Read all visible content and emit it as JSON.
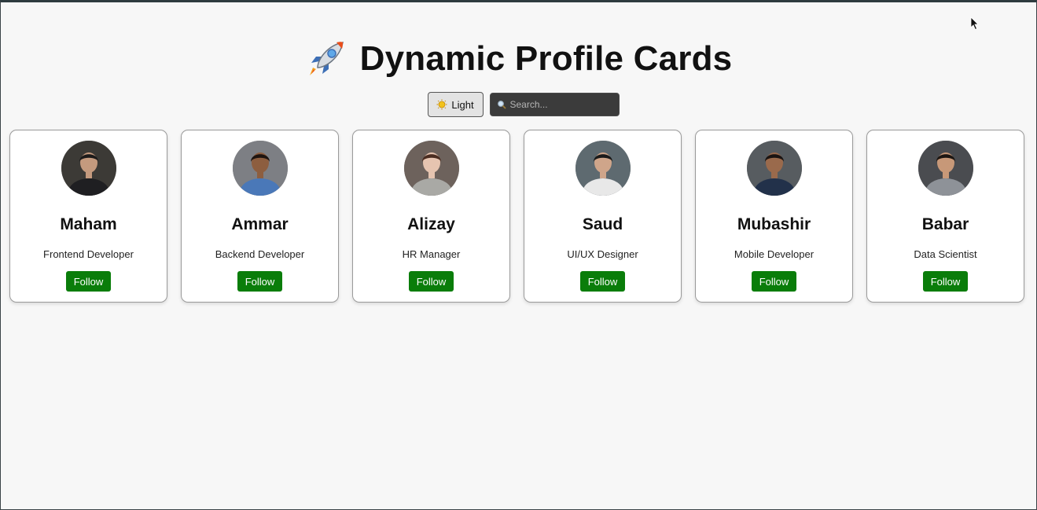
{
  "header": {
    "title": "Dynamic Profile Cards",
    "title_icon": "rocket-icon"
  },
  "controls": {
    "theme_label": "Light",
    "theme_icon": "sun-icon",
    "search_placeholder": "Search...",
    "search_value": "",
    "search_icon": "magnifier-icon"
  },
  "profiles": [
    {
      "name": "Maham",
      "role": "Frontend Developer",
      "follow_label": "Follow",
      "avatar_colors": {
        "bg": "#3c3a36",
        "skin": "#c49a7e",
        "hair": "#1c1a1a",
        "shirt": "#1f1f22"
      }
    },
    {
      "name": "Ammar",
      "role": "Backend Developer",
      "follow_label": "Follow",
      "avatar_colors": {
        "bg": "#7d7f84",
        "skin": "#8d5e3f",
        "hair": "#1e1410",
        "shirt": "#4a78b8"
      }
    },
    {
      "name": "Alizay",
      "role": "HR Manager",
      "follow_label": "Follow",
      "avatar_colors": {
        "bg": "#6d625c",
        "skin": "#e6c4b0",
        "hair": "#4a2c20",
        "shirt": "#a9a9a5"
      }
    },
    {
      "name": "Saud",
      "role": "UI/UX Designer",
      "follow_label": "Follow",
      "avatar_colors": {
        "bg": "#5e6a70",
        "skin": "#cfa58a",
        "hair": "#1a1a1a",
        "shirt": "#e8e8e8"
      }
    },
    {
      "name": "Mubashir",
      "role": "Mobile Developer",
      "follow_label": "Follow",
      "avatar_colors": {
        "bg": "#575c60",
        "skin": "#9a6a4c",
        "hair": "#1a1412",
        "shirt": "#22314a"
      }
    },
    {
      "name": "Babar",
      "role": "Data Scientist",
      "follow_label": "Follow",
      "avatar_colors": {
        "bg": "#4a4c50",
        "skin": "#c79878",
        "hair": "#1c1612",
        "shirt": "#8e9298"
      }
    }
  ],
  "colors": {
    "follow_button": "#0a7d0a",
    "page_bg": "#f7f7f7",
    "search_bg": "#3b3b3b"
  }
}
